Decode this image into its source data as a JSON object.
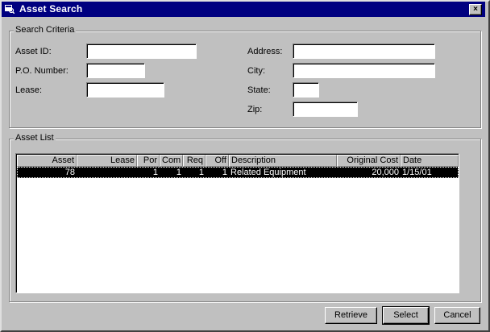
{
  "window": {
    "title": "Asset Search",
    "close_label": "×"
  },
  "criteria": {
    "group_label": "Search Criteria",
    "asset_id": {
      "label": "Asset ID:",
      "value": ""
    },
    "po_number": {
      "label": "P.O. Number:",
      "value": ""
    },
    "lease": {
      "label": "Lease:",
      "value": ""
    },
    "address": {
      "label": "Address:",
      "value": ""
    },
    "city": {
      "label": "City:",
      "value": ""
    },
    "state": {
      "label": "State:",
      "value": ""
    },
    "zip": {
      "label": "Zip:",
      "value": ""
    }
  },
  "asset_list": {
    "group_label": "Asset List",
    "columns": [
      "Asset",
      "Lease",
      "Por",
      "Com",
      "Req",
      "Off",
      "Description",
      "Original Cost",
      "Date"
    ],
    "rows": [
      {
        "asset": "78",
        "lease": "",
        "por": "1",
        "com": "1",
        "req": "1",
        "off": "1",
        "description": "Related Equipment",
        "original_cost": "20,000",
        "date": "1/15/01"
      }
    ]
  },
  "buttons": {
    "retrieve": "Retrieve",
    "select": "Select",
    "cancel": "Cancel"
  }
}
